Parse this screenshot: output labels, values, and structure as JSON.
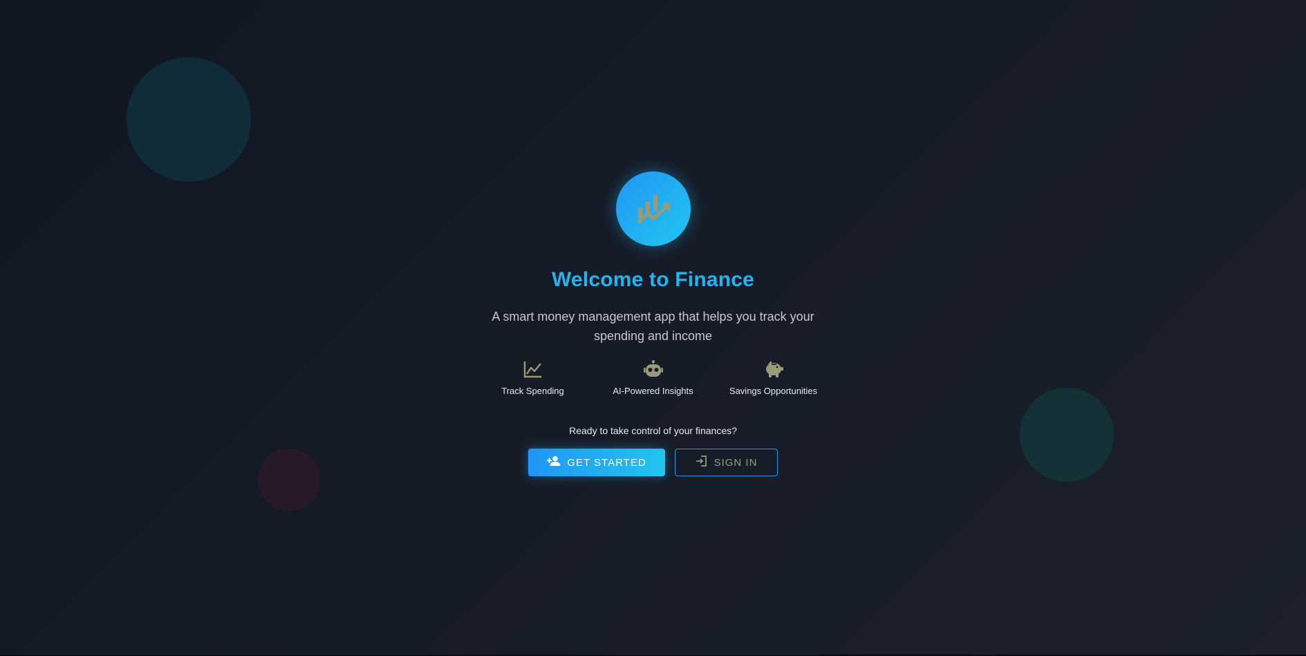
{
  "app": {
    "title": "Welcome to Finance",
    "subtitle": "A smart money management app that helps you track your spending and income"
  },
  "features": [
    {
      "icon": "line-chart-icon",
      "label": "Track Spending"
    },
    {
      "icon": "robot-icon",
      "label": "AI-Powered Insights"
    },
    {
      "icon": "piggy-bank-icon",
      "label": "Savings Opportunities"
    }
  ],
  "cta": {
    "prompt": "Ready to take control of your finances?",
    "get_started_label": "GET STARTED",
    "sign_in_label": "SIGN IN"
  },
  "icons": {
    "logo": "finance-chart-logo-icon",
    "get_started": "person-add-icon",
    "sign_in": "login-icon"
  },
  "colors": {
    "accent": "#2196f3",
    "accent_light": "#21c6f0",
    "title": "#22b4ee",
    "icon_olive": "#9a9a78",
    "background": "#141a24"
  }
}
